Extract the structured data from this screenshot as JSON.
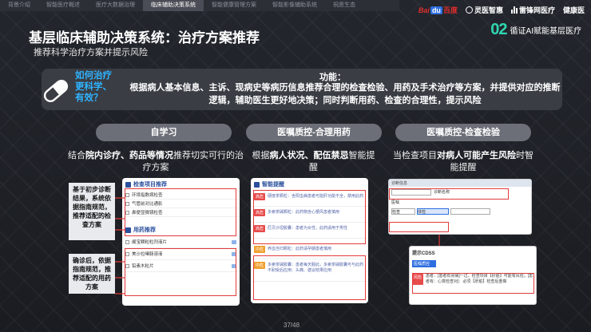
{
  "nav": {
    "tabs": [
      "背景介绍",
      "智能医疗概述",
      "医疗大数据治理",
      "临床辅助决策系统",
      "智能健康管理方案",
      "智能影像辅助系统",
      "祝愿生态"
    ],
    "active_index": 3
  },
  "logos": {
    "baidu_bai": "Bai",
    "baidu_du": "du",
    "baidu_cn": "百度",
    "lingyi": "灵医智惠",
    "leiyi": "雷锋网医疗",
    "jianyi": "健康医"
  },
  "section": {
    "number": "02",
    "label": "循证AI赋能基层医疗"
  },
  "title": "基层临床辅助决策系统：治疗方案推荐",
  "subtitle": "推荐科学治疗方案并提示风险",
  "function_box": {
    "question_line1": "如何治疗",
    "question_line2": "更科学、",
    "question_line3": "有效？",
    "heading": "功能：",
    "text": "根据病人基本信息、主诉、现病史等病历信息推荐合理的检查检验、用药及手术治疗等方案，并提供对应的推断逻辑，辅助医生更好地决策；同时判断用药、检查的合理性，提示风险"
  },
  "columns": [
    {
      "pill": "自学习",
      "desc_pre": "结合",
      "desc_bold": "院内诊疗、药品等情况",
      "desc_post": "推荐切实可行的治疗方案"
    },
    {
      "pill": "医嘱质控-合理用药",
      "desc_pre": "根据",
      "desc_bold": "病人状况、配伍禁忌",
      "desc_post": "智能提醒"
    },
    {
      "pill": "医嘱质控-检查检验",
      "desc_pre": "当检查项目",
      "desc_bold": "对病人可能产生风险",
      "desc_post": "时智能提醒"
    }
  ],
  "card1": {
    "exam_title": "检查项目推荐",
    "exam_items": [
      "环境指数病检查",
      "气管前对比通影",
      "鼻便显微镜检查"
    ],
    "drug_title": "用药推荐",
    "drug_items": [
      "阑宝颗粒粒剂液片",
      "美沙拉嗪肠溶液",
      "铅素木粒片"
    ],
    "note1": "基于初步诊断结果，系统依据指南规范，推荐适配的检查方案",
    "note2": "确诊后，依据指南规范，推荐适配的用药方案"
  },
  "card2": {
    "title": "智能提醒",
    "alerts": [
      {
        "tag": "高危",
        "color": "#e84b4b",
        "text": "硬度茶颗粒：含阳虫病患者可能肝功能不全，禁用此药"
      },
      {
        "tag": "高危",
        "color": "#e84b4b",
        "text": "多索茶碱颗粒：此药物含心梗风患者慎用"
      },
      {
        "tag": "高危",
        "color": "#e84b4b",
        "text": "厄贝沙坦胶囊：患者为女性，此药适用于男性"
      },
      {
        "tag": "中危",
        "color": "#f0a030",
        "text": "养血当归颗粒：此药请孕期患者慎用"
      },
      {
        "tag": "中危",
        "color": "#f0a030",
        "text": "多索茶碱胶囊：患者每天服此，多索茶碱胶囊可与此药不耐受后应用：头痛、建议结果应用"
      }
    ]
  },
  "card3": {
    "win1_title": "诊断信息",
    "field1": "诊断名称",
    "field2": "医嘱",
    "label_a": "检查",
    "label_b": "体检",
    "win2_title": "提示CDSS",
    "win2_sub": "医嘱质控",
    "risk_tag": "风险",
    "risk_text": "患者：[患者有肾病]一过、检查项目【肝脏】可能有风险；[患者有：心衰检查对]：必须【肝脏】检查后重做"
  },
  "pager": "37/48"
}
